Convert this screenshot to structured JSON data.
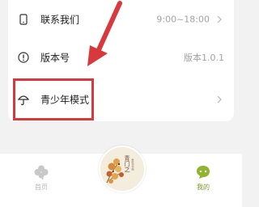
{
  "settings": {
    "rows": [
      {
        "label": "联系我们",
        "value": "9:00~18:00",
        "icon": "phone-icon",
        "has_chevron": true
      },
      {
        "label": "版本号",
        "value": "版本1.0.1",
        "icon": "info-icon",
        "has_chevron": false
      },
      {
        "label": "青少年模式",
        "value": "",
        "icon": "umbrella-icon",
        "has_chevron": true
      }
    ]
  },
  "tabbar": {
    "home_label": "首页",
    "center_title": "青门之",
    "center_subtitle": "新时代书院",
    "mine_label": "我的"
  },
  "colors": {
    "highlight": "#d9383c",
    "active_tab": "#7a9a28",
    "inactive_tab": "#b8b8b8"
  }
}
